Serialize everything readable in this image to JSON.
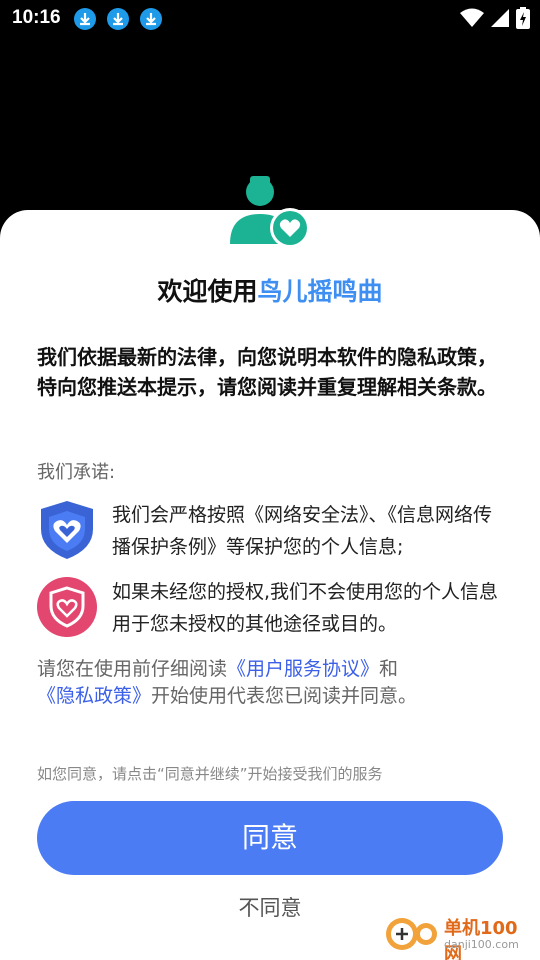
{
  "status": {
    "time": "10:16",
    "icons": [
      "download-icon",
      "download-icon",
      "download-icon",
      "wifi-icon",
      "signal-icon",
      "battery-charging-icon"
    ]
  },
  "dialog": {
    "title_prefix": "欢迎使用",
    "title_app": "鸟儿摇鸣曲",
    "intro": "我们依据最新的法律，向您说明本软件的隐私政策，特向您推送本提示，请您阅读并重复理解相关条款。",
    "promise_label": "我们承诺:",
    "promises": [
      {
        "icon": "shield-heart-icon",
        "text": "我们会严格按照《网络安全法》、《信息网络传播保护条例》等保护您的个人信息;"
      },
      {
        "icon": "shield-heart-pink-icon",
        "text": "如果未经您的授权,我们不会使用您的个人信息用于您未授权的其他途径或目的。"
      }
    ],
    "agree_text_1": "请您在使用前仔细阅读",
    "link_user_agreement": "《用户服务协议》",
    "agree_text_2": "和",
    "link_privacy": "《隐私政策》",
    "agree_text_3": "开始使用代表您已阅读并同意。",
    "hint": "如您同意，请点击“同意并继续”开始接受我们的服务",
    "agree_button": "同意",
    "disagree_button": "不同意"
  },
  "watermark": {
    "line1": "单机100网",
    "line2": "danji100.com"
  },
  "colors": {
    "accent": "#4b7cf3",
    "title_highlight": "#3f8ff2",
    "link": "#3b5fe6",
    "avatar": "#1bb394",
    "shield_blue": "#3a63d6",
    "shield_pink": "#e3466e"
  }
}
